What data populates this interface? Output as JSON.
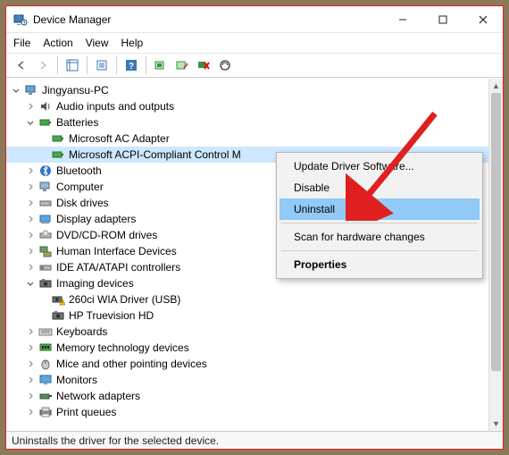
{
  "window": {
    "title": "Device Manager"
  },
  "menu": {
    "file": "File",
    "action": "Action",
    "view": "View",
    "help": "Help"
  },
  "status": "Uninstalls the driver for the selected device.",
  "context_menu": {
    "update": "Update Driver Software...",
    "disable": "Disable",
    "uninstall": "Uninstall",
    "scan": "Scan for hardware changes",
    "properties": "Properties"
  },
  "tree": {
    "root": "Jingyansu-PC",
    "audio": "Audio inputs and outputs",
    "batteries": "Batteries",
    "battery_ac": "Microsoft AC Adapter",
    "battery_acpi": "Microsoft ACPI-Compliant Control M",
    "bluetooth": "Bluetooth",
    "computer": "Computer",
    "disk": "Disk drives",
    "display": "Display adapters",
    "dvd": "DVD/CD-ROM drives",
    "hid": "Human Interface Devices",
    "ide": "IDE ATA/ATAPI controllers",
    "imaging": "Imaging devices",
    "imaging_wia": "260ci WIA Driver (USB)",
    "imaging_hp": "HP Truevision HD",
    "keyboards": "Keyboards",
    "memory": "Memory technology devices",
    "mice": "Mice and other pointing devices",
    "monitors": "Monitors",
    "network": "Network adapters",
    "print": "Print queues"
  }
}
